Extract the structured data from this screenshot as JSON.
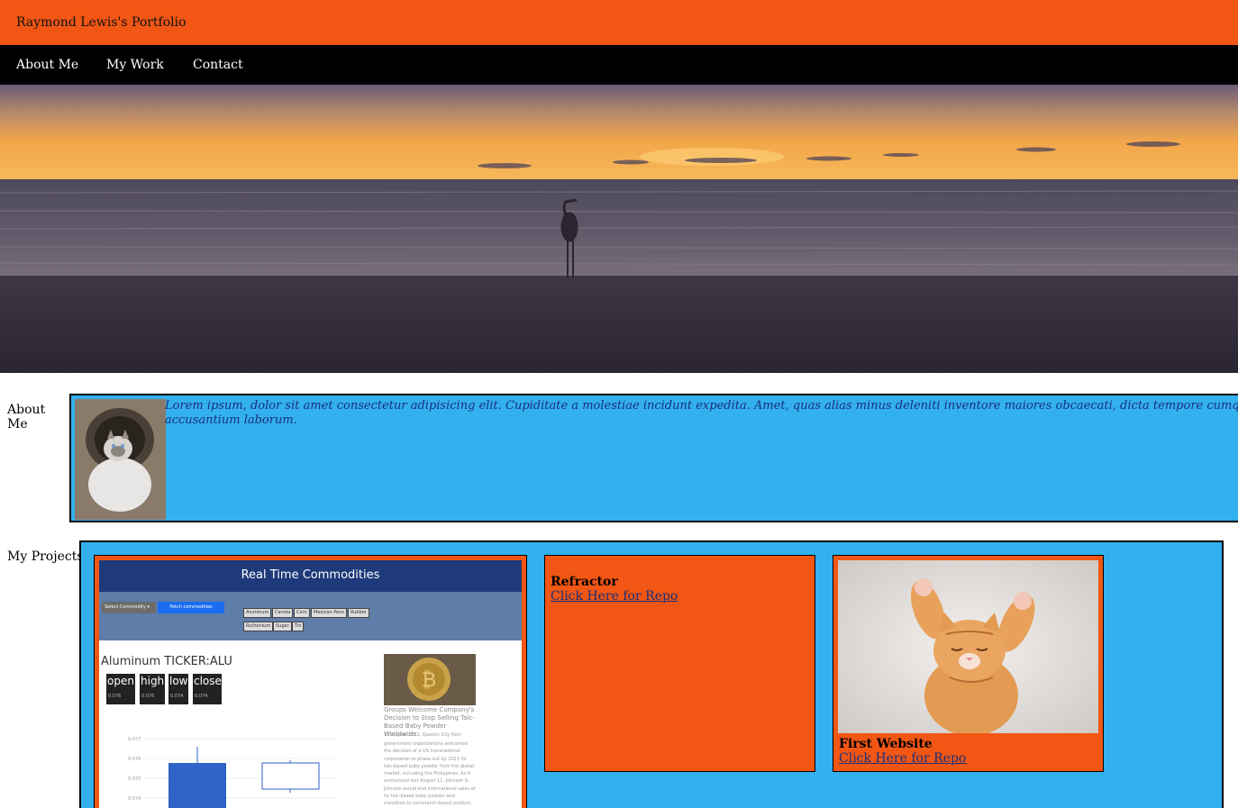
{
  "header": {
    "title": "Raymond Lewis's Portfolio"
  },
  "nav": {
    "items": [
      "About Me",
      "My Work",
      "Contact"
    ]
  },
  "about": {
    "label": "About Me",
    "text": "Lorem ipsum, dolor sit amet consectetur adipisicing elit. Cupiditate a molestiae incidunt expedita. Amet, quas alias minus deleniti inventore maiores obcaecati, dicta tempore cumque ab esse accusantium laborum."
  },
  "projects": {
    "label": "My Projects",
    "cards": [
      {
        "screenshot": {
          "app_title": "Real Time Commodities",
          "select_label": "Select Commodity",
          "fetch_label": "Fetch commodities",
          "chips": [
            "Aluminum",
            "Canola",
            "Corn",
            "Mexican Peso",
            "Rubber",
            "Ruthenium",
            "Sugar",
            "Tin"
          ],
          "commodity_heading": "Aluminum TICKER:ALU",
          "stats": [
            {
              "label": "open",
              "value": "0.076"
            },
            {
              "label": "high",
              "value": "0.076"
            },
            {
              "label": "low",
              "value": "0.074"
            },
            {
              "label": "close",
              "value": "0.074"
            }
          ],
          "news_title": "Groups Welcome Company's Decision to Stop Selling Talc-Based Baby Powder Worldwide",
          "news_date": "19 August 2022, Quezon City Non-",
          "news_body": "government organizations welcomed the decision of a US transnational corporation to phase out by 2023 its talc-based baby powder from the global market, including the Philippines. As it announced last August 11, Johnson & Johnson would end international sales of its talc-based baby powder and transition to cornstarch-based product.",
          "chart_ticks": [
            "0.077",
            "0.076",
            "0.075",
            "0.074"
          ]
        }
      },
      {
        "title": "Refractor",
        "link": "Click Here for Repo"
      },
      {
        "title": "First Website",
        "link": "Click Here for Repo"
      }
    ]
  },
  "colors": {
    "orange": "#f15614",
    "blue": "#33b0ee",
    "black": "#000000"
  }
}
